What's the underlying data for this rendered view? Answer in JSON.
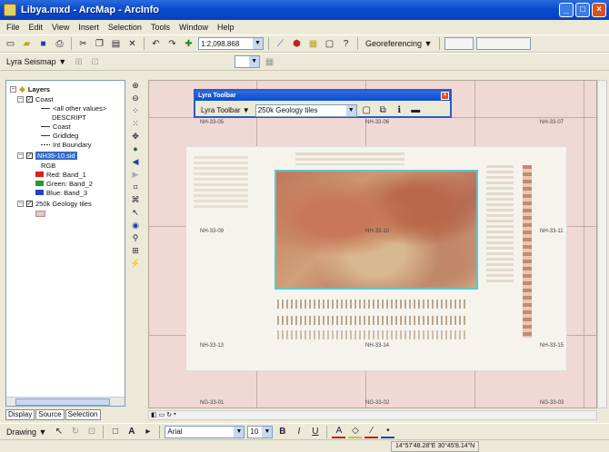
{
  "window": {
    "title": "Libya.mxd - ArcMap - ArcInfo",
    "min": "_",
    "max": "□",
    "close": "×"
  },
  "menu": [
    "File",
    "Edit",
    "View",
    "Insert",
    "Selection",
    "Tools",
    "Window",
    "Help"
  ],
  "toolbar1": {
    "scale": "1:2,098,868",
    "georef_menu": "Georeferencing ▼",
    "layer_combo": ""
  },
  "toolbar2": {
    "lyra_seismap": "Lyra Seismap ▼"
  },
  "toc": {
    "root": "Layers",
    "items": [
      {
        "label": "Coast",
        "kind": "layer",
        "checked": true
      },
      {
        "label": "<all other values>",
        "kind": "legend-line"
      },
      {
        "label": "DESCRIPT",
        "kind": "legend-text"
      },
      {
        "label": "Coast",
        "kind": "legend-line"
      },
      {
        "label": "Gridldeg",
        "kind": "legend-line"
      },
      {
        "label": "Int Boundary",
        "kind": "legend-line"
      },
      {
        "label": "NH35-10.sid",
        "kind": "layer-selected",
        "checked": true
      },
      {
        "label": "RGB",
        "kind": "legend-text"
      },
      {
        "label": "Red:  Band_1",
        "kind": "band",
        "color": "#e02020"
      },
      {
        "label": "Green: Band_2",
        "kind": "band",
        "color": "#20a020"
      },
      {
        "label": "Blue:  Band_3",
        "kind": "band",
        "color": "#2040d0"
      },
      {
        "label": "250k Geology tiles",
        "kind": "layer",
        "checked": true
      }
    ],
    "tabs": [
      "Display",
      "Source",
      "Selection"
    ]
  },
  "lyra_toolbar": {
    "title": "Lyra Toolbar",
    "menu": "Lyra Toolbar ▼",
    "combo": "250k Geology tiles"
  },
  "map": {
    "tile_labels": [
      "NH-33-05",
      "NH-33-06",
      "NH-33-07",
      "NH-33-09",
      "NH-33-10",
      "NH-33-11",
      "NH-33-13",
      "NH-33-14",
      "NH-33-15",
      "NG-33-01",
      "NG-33-02",
      "NG-33-03"
    ]
  },
  "drawbar": {
    "drawing": "Drawing ▼",
    "font": "Arial",
    "size": "10",
    "bold": "B",
    "italic": "I",
    "underline": "U"
  },
  "status": {
    "coords": "14°57'48.28\"E 30°45'8.14\"N"
  },
  "colors": {
    "accent": "#0a4bd0",
    "map_bg": "#f0d8d4",
    "selection_frame": "#5bc8d0"
  }
}
